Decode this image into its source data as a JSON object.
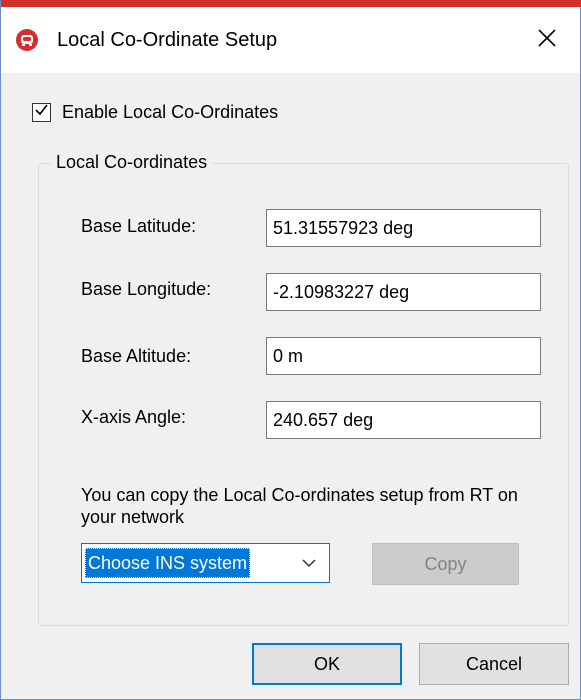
{
  "window": {
    "title": "Local Co-Ordinate Setup",
    "close_symbol": "✕"
  },
  "enable_checkbox": {
    "label": "Enable Local Co-Ordinates",
    "checked": true
  },
  "group": {
    "legend": "Local Co-ordinates",
    "fields": [
      {
        "label": "Base Latitude:",
        "value": "51.31557923 deg"
      },
      {
        "label": "Base Longitude:",
        "value": "-2.10983227 deg"
      },
      {
        "label": "Base Altitude:",
        "value": "0 m"
      },
      {
        "label": "X-axis Angle:",
        "value": "240.657 deg"
      }
    ],
    "info_text": "You can copy the Local Co-ordinates setup from RT on your network",
    "ins_select": {
      "selected": "Choose INS system"
    },
    "copy_label": "Copy"
  },
  "buttons": {
    "ok": "OK",
    "cancel": "Cancel"
  },
  "icons": {
    "app": "app-logo-icon",
    "close": "close-icon",
    "check": "checkmark-icon",
    "dropdown": "chevron-down-icon"
  },
  "colors": {
    "accent_red": "#d32f2f",
    "focus_blue": "#0078d7",
    "dialog_bg": "#f0f0f0"
  }
}
